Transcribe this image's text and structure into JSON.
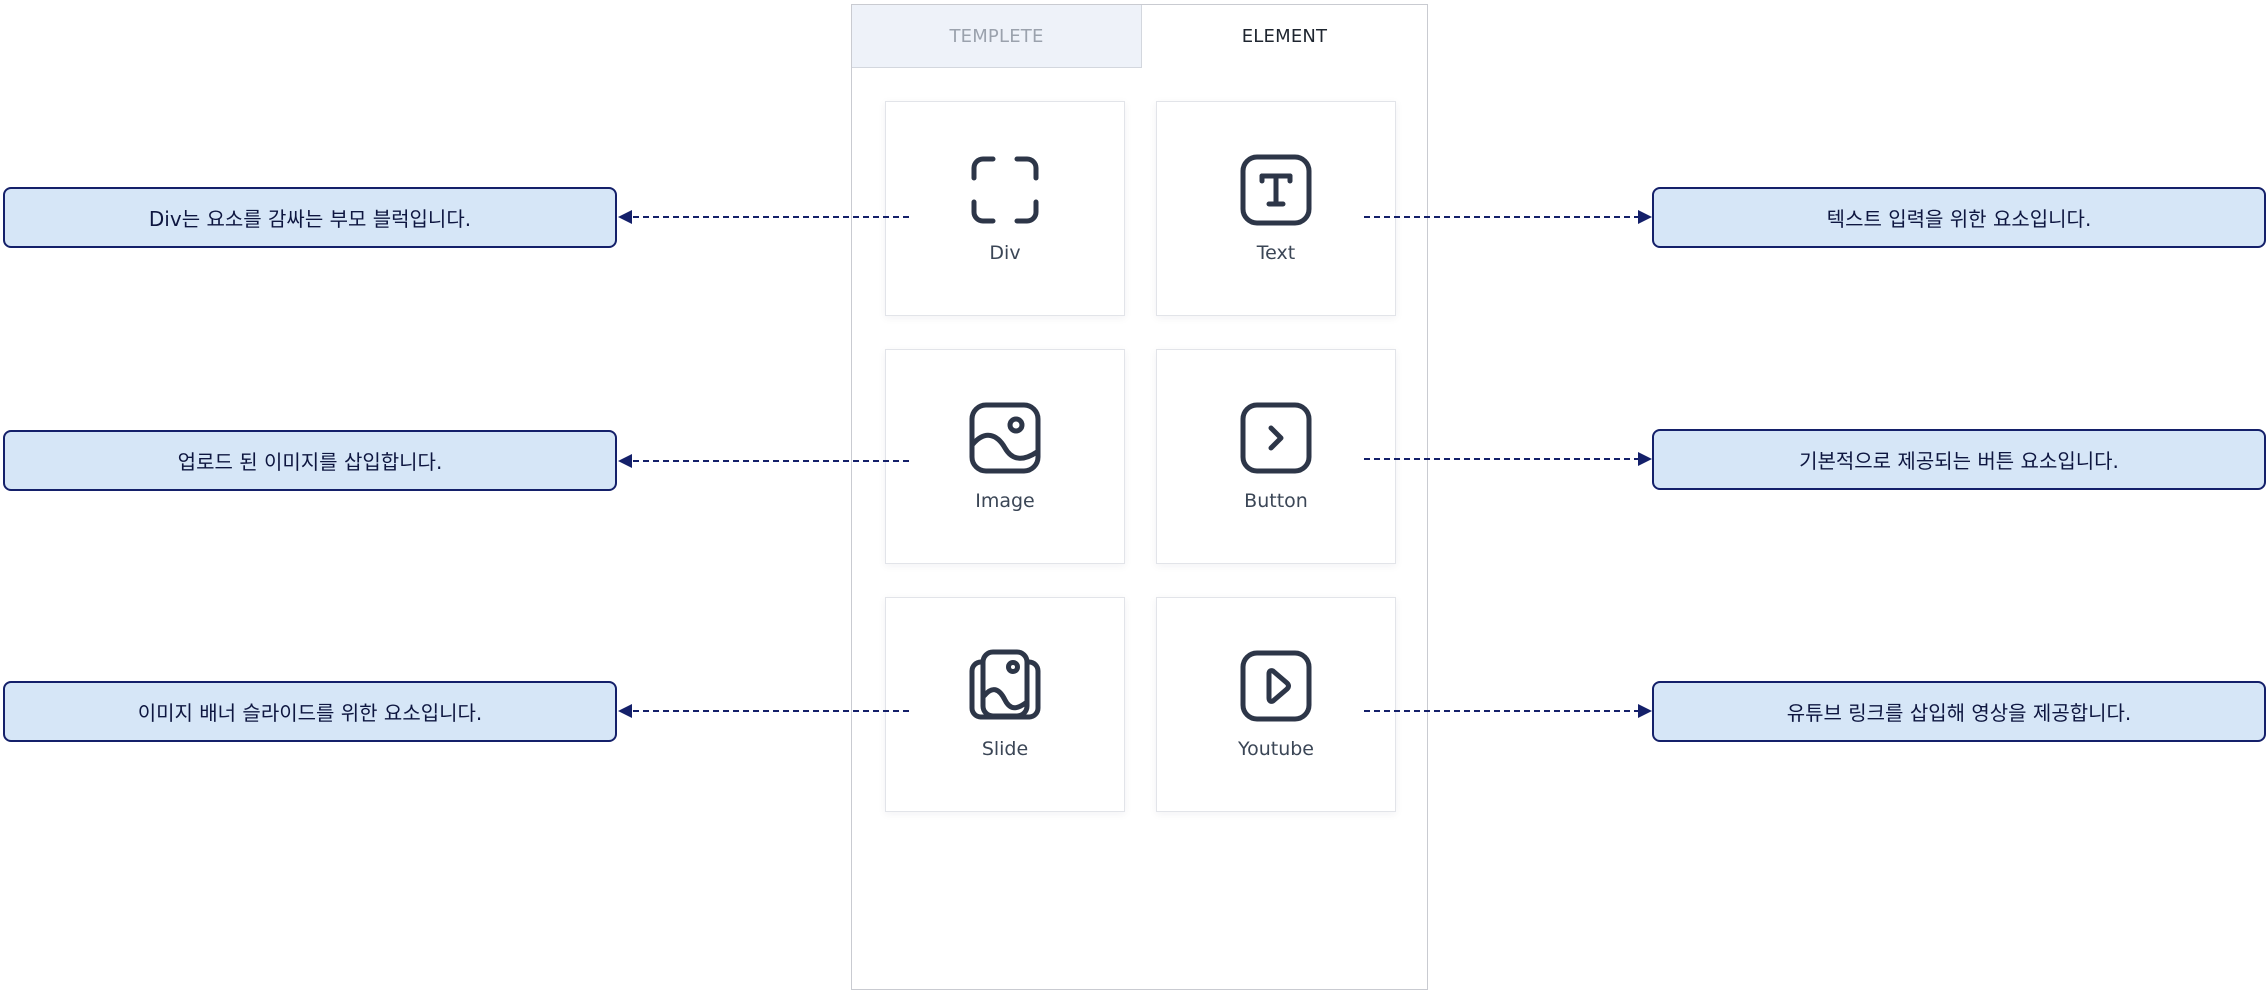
{
  "tabs": {
    "templete": "TEMPLETE",
    "element": "ELEMENT"
  },
  "elements": [
    {
      "label": "Div",
      "icon": "div-frame-icon"
    },
    {
      "label": "Text",
      "icon": "text-t-icon"
    },
    {
      "label": "Image",
      "icon": "image-icon"
    },
    {
      "label": "Button",
      "icon": "button-chevron-icon"
    },
    {
      "label": "Slide",
      "icon": "slide-images-icon"
    },
    {
      "label": "Youtube",
      "icon": "youtube-play-icon"
    }
  ],
  "annotations": {
    "div": "Div는 요소를 감싸는 부모 블럭입니다.",
    "text": "텍스트 입력을 위한 요소입니다.",
    "image": "업로드 된 이미지를 삽입합니다.",
    "button": "기본적으로 제공되는 버튼 요소입니다.",
    "slide": "이미지 배너 슬라이드를 위한 요소입니다.",
    "youtube": "유튜브 링크를 삽입해 영상을 제공합니다."
  },
  "colors": {
    "callout_fill": "#d6e6f7",
    "callout_border": "#14206a",
    "icon_stroke": "#2d3648",
    "connector": "#14206a"
  }
}
